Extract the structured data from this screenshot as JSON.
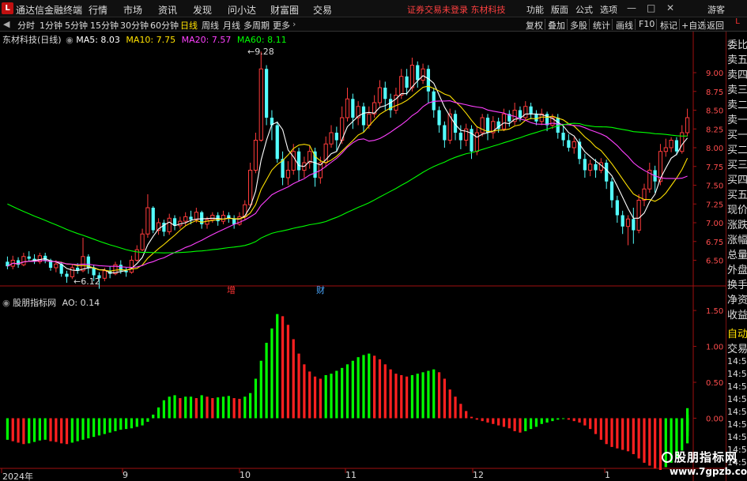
{
  "menubar": {
    "logo": "L",
    "app_title": "通达信金融终端",
    "items": [
      "行情",
      "市场",
      "资讯",
      "发现",
      "问小达",
      "财富圈",
      "交易"
    ],
    "notice": "证券交易未登录  东材科技",
    "right_items": [
      "功能",
      "版面",
      "公式",
      "选项"
    ],
    "user": "游客"
  },
  "toolbar": {
    "timeframes": [
      "分时",
      "1分钟",
      "5分钟",
      "15分钟",
      "30分钟",
      "60分钟",
      "日线",
      "周线",
      "月线",
      "多周期",
      "更多"
    ],
    "active": "日线",
    "right_buttons": [
      "复权",
      "叠加",
      "多股",
      "统计",
      "画线",
      "F10",
      "标记",
      "+自选",
      "返回"
    ],
    "corner": "L"
  },
  "main_legend": {
    "stock": "东材科技(日线)",
    "ma5": "MA5: 8.03",
    "ma10": "MA10: 7.75",
    "ma20": "MA20: 7.57",
    "ma60": "MA60: 8.11"
  },
  "indicator_legend": {
    "name": "股朋指标网",
    "value": "AO: 0.14"
  },
  "annotations": {
    "high": "9.28",
    "low": "6.12",
    "mark1": "增",
    "mark2": "财"
  },
  "x_axis": [
    "2024年",
    "9",
    "10",
    "11",
    "12",
    "1"
  ],
  "right_panel": [
    "委比",
    "卖五",
    "卖四",
    "卖三",
    "卖二",
    "卖一",
    "买一",
    "买二",
    "买三",
    "买四",
    "买五",
    "现价",
    "涨跌",
    "涨幅",
    "总量",
    "外盘",
    "换手",
    "净资",
    "收益"
  ],
  "right_panel_lower": [
    "自动",
    "交易",
    "14:56",
    "14:56",
    "14:56",
    "14:56",
    "14:56",
    "14:56",
    "14:56",
    "14:56",
    "14:56"
  ],
  "colors": {
    "up": "#ff3b3b",
    "down": "#54ffff",
    "ma5": "#ffffff",
    "ma10": "#ffe100",
    "ma20": "#ff40ff",
    "ma60": "#00ff00",
    "ao_up": "#00ff00",
    "ao_down": "#ff2020",
    "axis": "#a01010"
  },
  "chart_data": {
    "type": "candlestick",
    "price_ticks": [
      9.0,
      8.75,
      8.5,
      8.25,
      8.0,
      7.75,
      7.5,
      7.25,
      7.0,
      6.75,
      6.5
    ],
    "price_range": [
      6.2,
      9.4
    ],
    "candles": [
      [
        6.48,
        6.42,
        6.55,
        6.38
      ],
      [
        6.42,
        6.5,
        6.56,
        6.38
      ],
      [
        6.5,
        6.44,
        6.54,
        6.4
      ],
      [
        6.44,
        6.55,
        6.6,
        6.42
      ],
      [
        6.55,
        6.52,
        6.62,
        6.48
      ],
      [
        6.52,
        6.48,
        6.58,
        6.45
      ],
      [
        6.48,
        6.56,
        6.6,
        6.45
      ],
      [
        6.56,
        6.5,
        6.6,
        6.46
      ],
      [
        6.5,
        6.4,
        6.52,
        6.36
      ],
      [
        6.4,
        6.45,
        6.5,
        6.34
      ],
      [
        6.45,
        6.32,
        6.48,
        6.28
      ],
      [
        6.32,
        6.28,
        6.36,
        6.2
      ],
      [
        6.28,
        6.4,
        6.44,
        6.25
      ],
      [
        6.4,
        6.36,
        6.46,
        6.32
      ],
      [
        6.36,
        6.55,
        6.8,
        6.34
      ],
      [
        6.55,
        6.4,
        6.58,
        6.32
      ],
      [
        6.4,
        6.3,
        6.44,
        6.22
      ],
      [
        6.3,
        6.26,
        6.34,
        6.12
      ],
      [
        6.26,
        6.36,
        6.4,
        6.22
      ],
      [
        6.36,
        6.32,
        6.42,
        6.26
      ],
      [
        6.32,
        6.44,
        6.48,
        6.3
      ],
      [
        6.44,
        6.36,
        6.5,
        6.32
      ],
      [
        6.36,
        6.34,
        6.4,
        6.28
      ],
      [
        6.34,
        6.5,
        6.56,
        6.32
      ],
      [
        6.5,
        6.64,
        6.7,
        6.48
      ],
      [
        6.64,
        6.85,
        6.92,
        6.62
      ],
      [
        6.85,
        7.2,
        7.38,
        6.8
      ],
      [
        7.2,
        6.9,
        7.22,
        6.86
      ],
      [
        6.9,
        7.0,
        7.06,
        6.84
      ],
      [
        7.0,
        6.88,
        7.04,
        6.82
      ],
      [
        6.88,
        7.06,
        7.12,
        6.84
      ],
      [
        7.06,
        6.96,
        7.1,
        6.9
      ],
      [
        6.96,
        7.02,
        7.08,
        6.92
      ],
      [
        7.02,
        7.08,
        7.14,
        6.96
      ],
      [
        7.08,
        7.04,
        7.16,
        6.98
      ],
      [
        7.04,
        7.14,
        7.2,
        7.0
      ],
      [
        7.14,
        6.98,
        7.16,
        6.92
      ],
      [
        6.98,
        7.04,
        7.08,
        6.92
      ],
      [
        7.04,
        7.1,
        7.14,
        7.0
      ],
      [
        7.1,
        7.02,
        7.14,
        6.96
      ],
      [
        7.02,
        7.1,
        7.16,
        6.98
      ],
      [
        7.1,
        7.06,
        7.14,
        7.0
      ],
      [
        7.06,
        6.98,
        7.1,
        6.92
      ],
      [
        6.98,
        7.08,
        7.14,
        6.96
      ],
      [
        7.08,
        7.24,
        7.3,
        7.04
      ],
      [
        7.24,
        7.7,
        7.8,
        7.2
      ],
      [
        7.7,
        8.1,
        8.2,
        7.66
      ],
      [
        8.1,
        9.05,
        9.28,
        8.08
      ],
      [
        9.05,
        8.4,
        9.1,
        8.3
      ],
      [
        8.4,
        8.3,
        8.5,
        8.1
      ],
      [
        8.3,
        7.85,
        8.35,
        7.8
      ],
      [
        7.85,
        7.6,
        7.95,
        7.5
      ],
      [
        7.6,
        7.7,
        7.82,
        7.5
      ],
      [
        7.7,
        7.95,
        8.05,
        7.64
      ],
      [
        7.95,
        7.7,
        8.0,
        7.55
      ],
      [
        7.7,
        7.8,
        7.88,
        7.6
      ],
      [
        7.8,
        7.95,
        8.02,
        7.72
      ],
      [
        7.95,
        7.6,
        8.0,
        7.48
      ],
      [
        7.6,
        7.8,
        7.88,
        7.52
      ],
      [
        7.8,
        8.05,
        8.15,
        7.74
      ],
      [
        8.05,
        8.2,
        8.3,
        8.0
      ],
      [
        8.2,
        8.1,
        8.28,
        7.95
      ],
      [
        8.1,
        8.4,
        8.55,
        8.05
      ],
      [
        8.4,
        8.65,
        8.8,
        8.35
      ],
      [
        8.65,
        8.4,
        8.72,
        8.25
      ],
      [
        8.4,
        8.55,
        8.62,
        8.3
      ],
      [
        8.55,
        8.3,
        8.6,
        8.2
      ],
      [
        8.3,
        8.45,
        8.55,
        8.25
      ],
      [
        8.45,
        8.6,
        8.7,
        8.4
      ],
      [
        8.6,
        8.8,
        8.9,
        8.55
      ],
      [
        8.8,
        8.65,
        8.88,
        8.5
      ],
      [
        8.65,
        8.5,
        8.72,
        8.4
      ],
      [
        8.5,
        8.7,
        8.8,
        8.45
      ],
      [
        8.7,
        8.95,
        9.05,
        8.65
      ],
      [
        8.95,
        8.8,
        9.05,
        8.7
      ],
      [
        8.8,
        9.1,
        9.2,
        8.75
      ],
      [
        9.1,
        8.9,
        9.15,
        8.8
      ],
      [
        8.9,
        9.05,
        9.12,
        8.85
      ],
      [
        9.05,
        8.75,
        9.1,
        8.6
      ],
      [
        8.75,
        8.5,
        8.8,
        8.4
      ],
      [
        8.5,
        8.3,
        8.55,
        8.2
      ],
      [
        8.3,
        8.1,
        8.35,
        8.0
      ],
      [
        8.1,
        8.45,
        8.52,
        8.05
      ],
      [
        8.45,
        8.2,
        8.5,
        8.1
      ],
      [
        8.2,
        8.1,
        8.3,
        7.98
      ],
      [
        8.1,
        8.25,
        8.32,
        8.02
      ],
      [
        8.25,
        7.95,
        8.3,
        7.85
      ],
      [
        7.95,
        8.2,
        8.28,
        7.9
      ],
      [
        8.2,
        8.4,
        8.45,
        8.15
      ],
      [
        8.4,
        8.2,
        8.45,
        8.1
      ],
      [
        8.2,
        8.35,
        8.42,
        8.12
      ],
      [
        8.35,
        8.25,
        8.4,
        8.2
      ],
      [
        8.25,
        8.45,
        8.52,
        8.22
      ],
      [
        8.45,
        8.35,
        8.5,
        8.28
      ],
      [
        8.35,
        8.5,
        8.6,
        8.3
      ],
      [
        8.5,
        8.4,
        8.55,
        8.35
      ],
      [
        8.4,
        8.55,
        8.62,
        8.36
      ],
      [
        8.55,
        8.45,
        8.6,
        8.38
      ],
      [
        8.45,
        8.35,
        8.5,
        8.3
      ],
      [
        8.35,
        8.45,
        8.52,
        8.3
      ],
      [
        8.45,
        8.3,
        8.48,
        8.22
      ],
      [
        8.3,
        8.4,
        8.45,
        8.25
      ],
      [
        8.4,
        8.2,
        8.45,
        8.12
      ],
      [
        8.2,
        8.1,
        8.28,
        8.02
      ],
      [
        8.1,
        8.0,
        8.18,
        7.95
      ],
      [
        8.0,
        8.08,
        8.14,
        7.92
      ],
      [
        8.08,
        7.85,
        8.12,
        7.78
      ],
      [
        7.85,
        7.7,
        7.92,
        7.6
      ],
      [
        7.7,
        7.78,
        7.84,
        7.62
      ],
      [
        7.78,
        7.7,
        7.85,
        7.6
      ],
      [
        7.7,
        7.8,
        7.86,
        7.66
      ],
      [
        7.8,
        7.55,
        7.84,
        7.45
      ],
      [
        7.55,
        7.3,
        7.6,
        7.2
      ],
      [
        7.3,
        7.1,
        7.36,
        7.0
      ],
      [
        7.1,
        6.95,
        7.16,
        6.85
      ],
      [
        6.95,
        7.05,
        7.1,
        6.7
      ],
      [
        7.05,
        6.9,
        7.2,
        6.72
      ],
      [
        6.9,
        7.3,
        7.38,
        6.86
      ],
      [
        7.3,
        7.45,
        7.52,
        7.22
      ],
      [
        7.45,
        7.7,
        7.8,
        7.4
      ],
      [
        7.7,
        7.55,
        7.76,
        7.4
      ],
      [
        7.55,
        7.95,
        8.05,
        7.5
      ],
      [
        7.95,
        8.0,
        8.12,
        7.88
      ],
      [
        8.0,
        8.1,
        8.14,
        7.94
      ],
      [
        8.1,
        7.95,
        8.14,
        7.9
      ],
      [
        7.95,
        8.2,
        8.3,
        7.92
      ],
      [
        8.2,
        8.4,
        8.52,
        8.15
      ]
    ],
    "ao_range": [
      -0.72,
      1.6
    ],
    "ao_ticks": [
      1.5,
      1.0,
      0.5,
      0.0
    ],
    "ao": [
      -0.3,
      -0.32,
      -0.34,
      -0.36,
      -0.35,
      -0.33,
      -0.31,
      -0.3,
      -0.32,
      -0.33,
      -0.35,
      -0.36,
      -0.34,
      -0.32,
      -0.3,
      -0.28,
      -0.26,
      -0.24,
      -0.22,
      -0.2,
      -0.18,
      -0.16,
      -0.15,
      -0.14,
      -0.12,
      -0.1,
      -0.05,
      0.05,
      0.15,
      0.25,
      0.3,
      0.32,
      0.28,
      0.3,
      0.3,
      0.28,
      0.32,
      0.3,
      0.28,
      0.29,
      0.3,
      0.31,
      0.28,
      0.27,
      0.3,
      0.35,
      0.55,
      0.8,
      1.05,
      1.25,
      1.45,
      1.42,
      1.3,
      1.1,
      0.9,
      0.75,
      0.65,
      0.58,
      0.55,
      0.6,
      0.62,
      0.66,
      0.7,
      0.75,
      0.8,
      0.85,
      0.88,
      0.9,
      0.87,
      0.82,
      0.75,
      0.68,
      0.62,
      0.6,
      0.58,
      0.6,
      0.62,
      0.64,
      0.66,
      0.68,
      0.64,
      0.55,
      0.4,
      0.3,
      0.2,
      0.1,
      0.02,
      -0.02,
      -0.04,
      -0.06,
      -0.08,
      -0.1,
      -0.12,
      -0.14,
      -0.18,
      -0.2,
      -0.18,
      -0.15,
      -0.12,
      -0.08,
      -0.06,
      -0.04,
      -0.02,
      -0.01,
      -0.02,
      -0.04,
      -0.06,
      -0.1,
      -0.15,
      -0.22,
      -0.3,
      -0.36,
      -0.4,
      -0.42,
      -0.44,
      -0.46,
      -0.5,
      -0.56,
      -0.62,
      -0.66,
      -0.7,
      -0.72,
      -0.68,
      -0.62,
      -0.55,
      -0.45,
      -0.35,
      -0.25,
      -0.18,
      -0.1,
      0.05,
      0.14
    ],
    "x_labels": [
      "2024年",
      "9",
      "10",
      "11",
      "12",
      "1"
    ]
  }
}
